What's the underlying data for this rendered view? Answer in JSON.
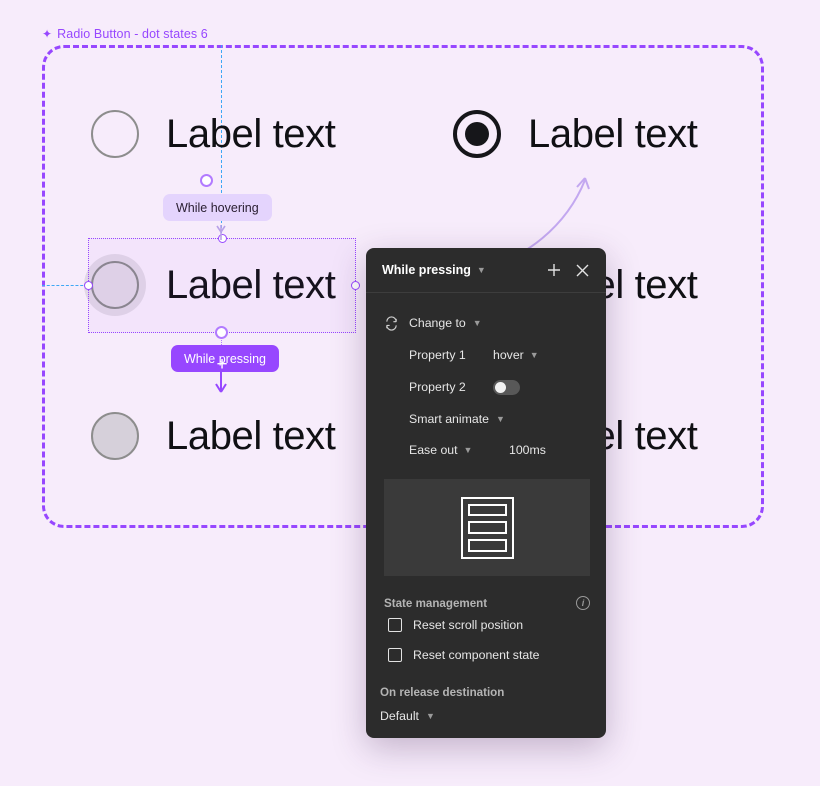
{
  "canvas": {
    "frame_title": "Radio Button - dot states 6",
    "frame_icon": "diamond-component-icon",
    "background_color": "#f7ecfb",
    "frame_border_color": "#9747ff"
  },
  "radios": [
    {
      "label": "Label text",
      "state": "default",
      "selected": false
    },
    {
      "label": "Label text",
      "state": "selected",
      "selected": true
    },
    {
      "label": "Label text",
      "state": "hover",
      "selected": false
    },
    {
      "label": "Label text",
      "state": "pressed",
      "selected": false
    }
  ],
  "interaction_badges": [
    {
      "label": "While hovering",
      "style": "light"
    },
    {
      "label": "While pressing",
      "style": "solid"
    }
  ],
  "panel": {
    "title": "While pressing",
    "header_icons": [
      "chevron-down-icon",
      "plus-icon",
      "close-icon"
    ],
    "action": {
      "icon": "change-to-icon",
      "label": "Change to"
    },
    "properties": [
      {
        "name": "Property 1",
        "value": "hover",
        "control": "dropdown"
      },
      {
        "name": "Property 2",
        "value": "off",
        "control": "toggle"
      }
    ],
    "animation": {
      "type": "Smart animate",
      "easing": "Ease out",
      "duration": "100ms"
    },
    "preview_icon": "list-stack-preview",
    "state_management": {
      "title": "State management",
      "info_icon": "info-icon",
      "options": [
        {
          "label": "Reset scroll position",
          "checked": false
        },
        {
          "label": "Reset component state",
          "checked": false
        }
      ]
    },
    "on_release": {
      "title": "On release destination",
      "value": "Default"
    }
  }
}
